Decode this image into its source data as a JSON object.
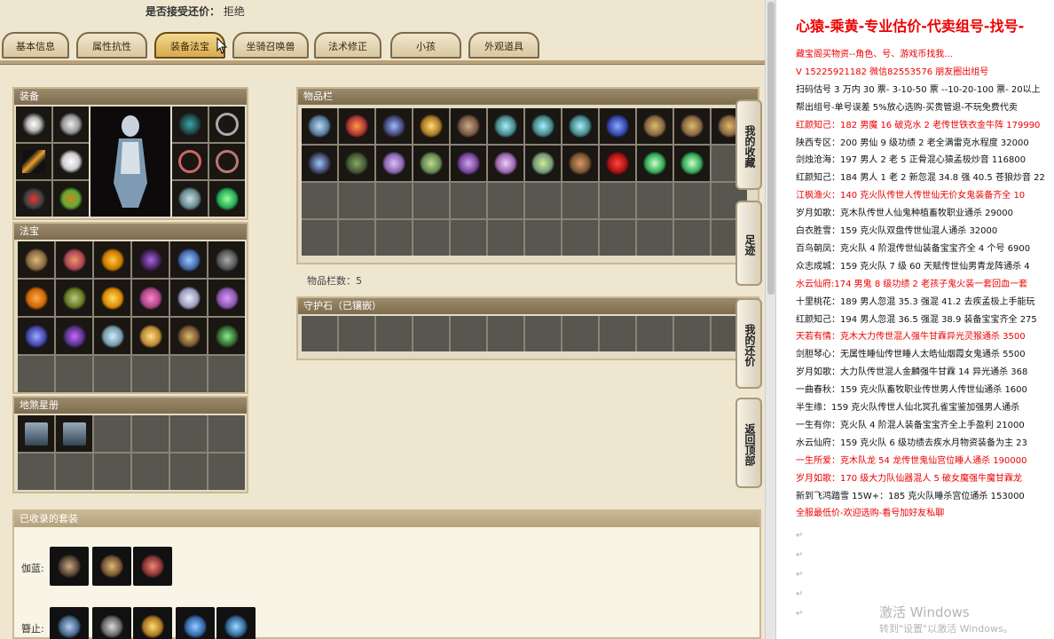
{
  "top_line": {
    "label": "是否接受还价：",
    "value": "拒绝"
  },
  "tabs": [
    "基本信息",
    "属性抗性",
    "装备法宝",
    "坐骑召唤兽",
    "法术修正",
    "小孩",
    "外观道具"
  ],
  "panels": {
    "equipment": "装备",
    "fabao": "法宝",
    "dizhang": "地煞星册",
    "inventory": "物品栏",
    "inventory_count": "物品栏数：5",
    "guard_stone": "守护石（已镶嵌）",
    "collected_sets": "已收录的套装"
  },
  "collected": {
    "row1_label": "伽蓝:",
    "row2_label": "簪止:"
  },
  "side_buttons": [
    "我的收藏",
    "足迹",
    "我的还价",
    "返回顶部"
  ],
  "right": {
    "title": "心猿-乘黄-专业估价-代卖组号-找号-",
    "lines": [
      {
        "text": "藏宝阁买物资--角色、号、游戏币找我…",
        "red": true
      },
      {
        "text": "V 15225921182 微信82553576 朋友圈出组号",
        "red": true
      },
      {
        "text": "扫码估号 3 万内 30 票- 3-10-50 票 --10-20-100 票- 20以上",
        "red": false
      },
      {
        "text": "帮出组号-单号误差 5%放心选购-买贵管退-不玩免费代卖",
        "red": false
      },
      {
        "text": "红颜知己：182 男魔 16 破克水 2 老传世铁衣金牛阵 179990",
        "red": true
      },
      {
        "text": "陕西专区：200 男仙 9 级功绩 2 老全满雷克水程度 32000",
        "red": false
      },
      {
        "text": "剑烛沧海：197 男人 2 老 5 正骨混心猿孟极炒音 116800",
        "red": false
      },
      {
        "text": "红颜知己：184 男人 1 老 2 新忽混 34.8 强 40.5 苍狼炒音 22",
        "red": false
      },
      {
        "text": "江枫渔火：140 克火队传世人传世仙无价女鬼装备齐全 10",
        "red": true
      },
      {
        "text": "岁月如歌：克木队传世人仙鬼种植畜牧职业通杀 29000",
        "red": false
      },
      {
        "text": "白衣胜雪：159 克火队双盘传世仙混人通杀 32000",
        "red": false
      },
      {
        "text": "百鸟朝凤：克火队 4 阶混传世仙装备宝宝齐全 4 个号 6900",
        "red": false
      },
      {
        "text": "众志成城：159 克火队 7 级 60 天赋传世仙男青龙阵通杀 4",
        "red": false
      },
      {
        "text": "水云仙府:174 男鬼 8 级功绩 2 老孩子鬼火装一套回血一套",
        "red": true
      },
      {
        "text": "十里桃花：189 男人忽混 35.3 强混 41.2 去疾孟极上手能玩",
        "red": false
      },
      {
        "text": "红颜知己：194 男人忽混 36.5 强混 38.9 装备宝宝齐全 275",
        "red": false
      },
      {
        "text": "天若有情：克木大力传世混人强牛甘霖异光灵猴通杀 3500",
        "red": true
      },
      {
        "text": "剑胆琴心：无属性睡仙传世睡人太皓仙烟霞女鬼通杀 5500",
        "red": false
      },
      {
        "text": "岁月如歌：大力队传世混人金麟强牛甘霖 14 异光通杀 368",
        "red": false
      },
      {
        "text": "一曲春秋：159 克火队畜牧职业传世男人传世仙通杀 1600",
        "red": false
      },
      {
        "text": "半生缘：159 克火队传世人仙北冥孔雀宝鉴加强男人通杀",
        "red": false
      },
      {
        "text": "一生有你：克火队 4 阶混人装备宝宝齐全上手盈利 21000",
        "red": false
      },
      {
        "text": "水云仙府：159 克火队 6 级功绩去疾水月物资装备为主 23",
        "red": false
      },
      {
        "text": "一生所爱：克木队龙 54 龙传世鬼仙宫位睡人通杀 190000",
        "red": true
      },
      {
        "text": "岁月如歌：170 级大力队仙器混人 5 破女魔强牛魔甘霖龙",
        "red": true
      },
      {
        "text": "新到飞鸿踏雪 15W+：185 克火队睡杀宫位通杀 153000",
        "red": false
      },
      {
        "text": "全服最低价-欢迎选购-看号加好友私聊",
        "red": true
      }
    ],
    "watermark1": "激活 Windows",
    "watermark2": "转到\"设置\"以激活 Windows。"
  }
}
